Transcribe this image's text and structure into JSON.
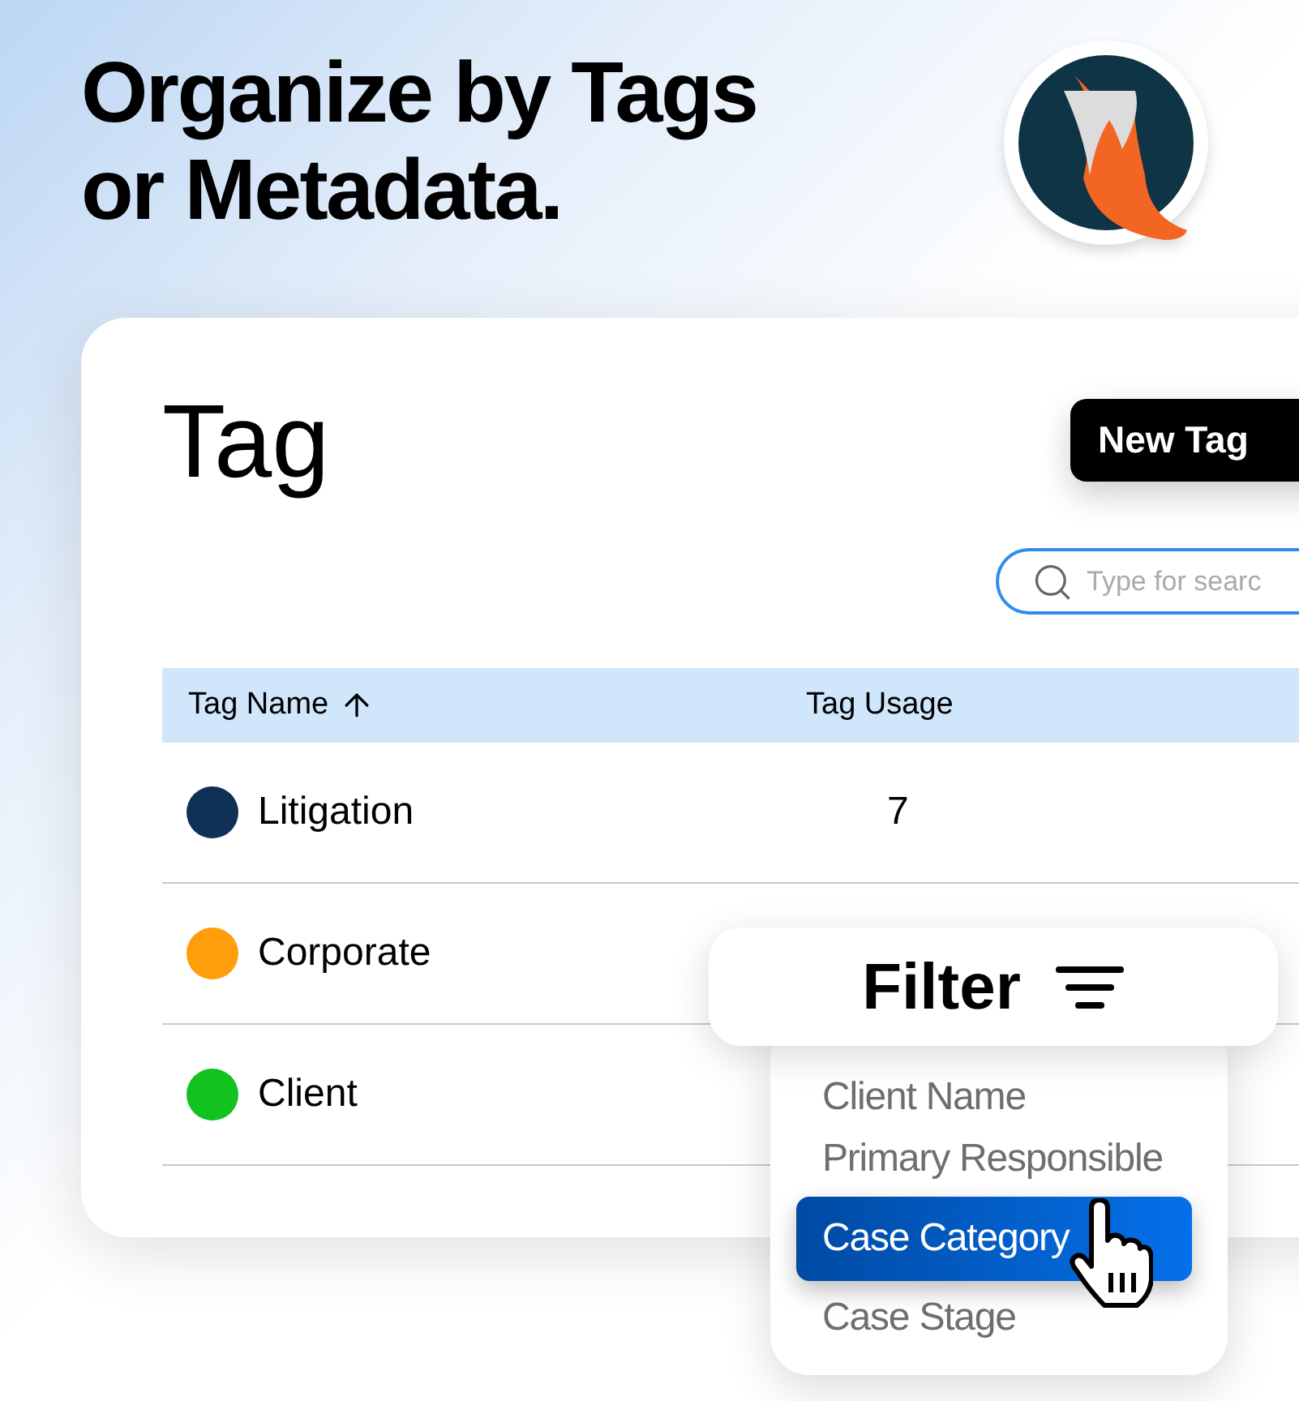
{
  "headline": {
    "lines": [
      "Organize by Tags",
      "or Metadata."
    ]
  },
  "panel": {
    "title": "Tag",
    "new_button": "New Tag",
    "search": {
      "placeholder": "Type for searc"
    },
    "table": {
      "columns": [
        {
          "label": "Tag Name",
          "sort_ascending": true
        },
        {
          "label": "Tag Usage"
        }
      ],
      "rows": [
        {
          "name": "Litigation",
          "color": "#0f3057",
          "usage": "7"
        },
        {
          "name": "Corporate",
          "color": "#ff9d0a"
        },
        {
          "name": "Client",
          "color": "#12c21f"
        }
      ]
    }
  },
  "filter": {
    "label": "Filter",
    "options": [
      {
        "label": "Client Name",
        "selected": false
      },
      {
        "label": "Primary Responsible",
        "selected": false
      },
      {
        "label": "Case Category",
        "selected": true
      },
      {
        "label": "Case Stage",
        "selected": false
      }
    ]
  }
}
